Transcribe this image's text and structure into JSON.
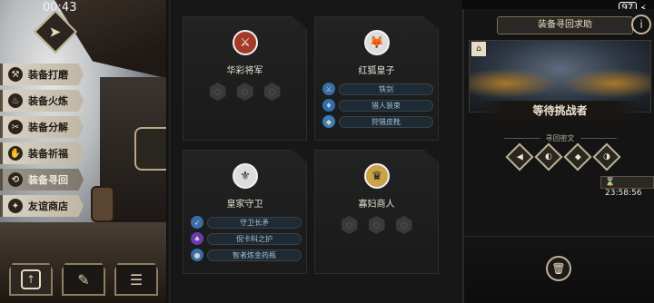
{
  "status": {
    "time": "00:43",
    "battery": "97",
    "charging_glyph": "⚡"
  },
  "menu": [
    {
      "label": "装备打磨",
      "icon": "hammer-icon",
      "glyph": "⚒"
    },
    {
      "label": "装备火炼",
      "icon": "flame-icon",
      "glyph": "♨"
    },
    {
      "label": "装备分解",
      "icon": "break-icon",
      "glyph": "✂"
    },
    {
      "label": "装备祈福",
      "icon": "pray-icon",
      "glyph": "✋"
    },
    {
      "label": "装备寻回",
      "icon": "recover-icon",
      "glyph": "⟲",
      "active": true
    },
    {
      "label": "友谊商店",
      "icon": "shop-icon",
      "glyph": "✦"
    }
  ],
  "cards": [
    {
      "name": "华彩将军",
      "avatar": "⚔",
      "style": "red",
      "slots": [
        "",
        "",
        ""
      ]
    },
    {
      "name": "红狐皇子",
      "avatar": "🦊",
      "style": "",
      "items": [
        {
          "label": "铁剑",
          "gem_color": "#3a6ea8",
          "gem_glyph": "⚔"
        },
        {
          "label": "猎人装束",
          "gem_color": "#2f6fae",
          "gem_glyph": "♦"
        },
        {
          "label": "狩猎皮靴",
          "gem_color": "#3b7db5",
          "gem_glyph": "◆"
        }
      ]
    },
    {
      "name": "皇家守卫",
      "avatar": "⚜",
      "style": "",
      "items": [
        {
          "label": "守卫长矛",
          "gem_color": "#3a6ea8",
          "gem_glyph": "➶"
        },
        {
          "label": "倪卡科之护",
          "gem_color": "#6a3ab0",
          "gem_glyph": "♠"
        },
        {
          "label": "智者炼金药瓶",
          "gem_color": "#2f6fae",
          "gem_glyph": "●"
        }
      ]
    },
    {
      "name": "寡妇商人",
      "avatar": "♛",
      "style": "gold",
      "slots": [
        "",
        "",
        ""
      ]
    }
  ],
  "right": {
    "title": "装备寻回求助",
    "info_glyph": "i",
    "banner_chip": "⌂",
    "challenger": "等待挑战者",
    "sub": "寻回密文",
    "runes": [
      "◀",
      "◐",
      "◆",
      "◑"
    ],
    "timer": "23:58:56",
    "timer_glyph": "⌛"
  },
  "bottom": [
    {
      "icon": "arrow-up-icon",
      "glyph": "↑",
      "active": true
    },
    {
      "icon": "feather-icon",
      "glyph": "✎",
      "active": false
    },
    {
      "icon": "list-icon",
      "glyph": "☰",
      "active": false
    }
  ]
}
